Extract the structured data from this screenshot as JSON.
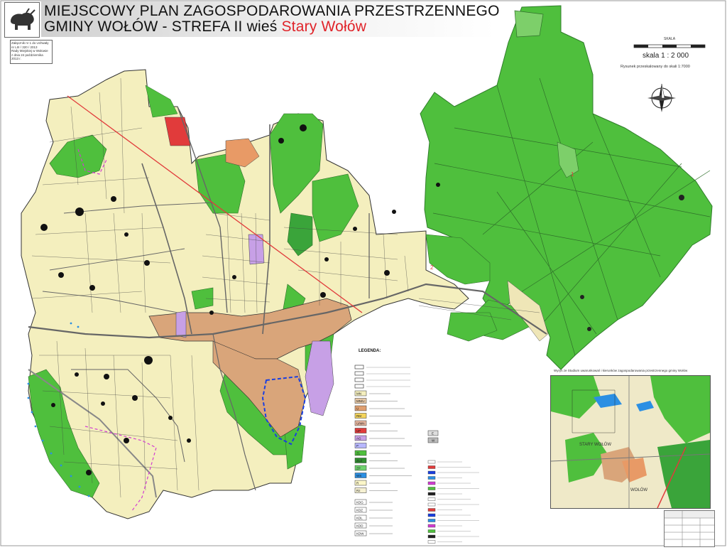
{
  "title": {
    "line1": "MIEJSCOWY  PLAN  ZAGOSPODAROWANIA PRZESTRZENNEGO",
    "line2_prefix": "GMINY WOŁÓW - STREFA II wieś ",
    "line2_place": "Stary Wołów"
  },
  "notes": {
    "line1": "Załącznik nr 1 do Uchwały",
    "line2": "nr LIII / 320 / 2013",
    "line3": "Rady Miejskiej w Wołowie",
    "line4": "z dnia 24 października 2013 r."
  },
  "scale": {
    "label": "SKALA",
    "text": "skala 1 : 2 000",
    "note": "Rysunek przeskalowany do skali 1:7000"
  },
  "legend": {
    "title": "LEGENDA:",
    "codes": [
      "MN",
      "MN/U",
      "U",
      "RM",
      "U/MN",
      "UP",
      "AG",
      "P",
      "ZL",
      "ZLd",
      "ZP",
      "WS",
      "R",
      "Rz"
    ],
    "codes2": [
      "KDG",
      "KDZ",
      "KDL",
      "KDD",
      "KDW"
    ],
    "codes3": [
      "E",
      "W"
    ]
  },
  "inset": {
    "caption": "Wyrys ze Studium uwarunkowań i kierunków zagospodarowania przestrzennego gminy Wołów",
    "place1": "STARY WOŁÓW",
    "place2": "WOŁÓW"
  },
  "colors": {
    "forest": "#4fbf3d",
    "forest_dark": "#2f8f2f",
    "residential": "#f4efbe",
    "mixed": "#d9a57a",
    "service": "#c7a0e6",
    "road": "#777777",
    "boundary": "#e13b3b",
    "water": "#2b8fe3"
  },
  "map_labels": [
    "1",
    "2"
  ]
}
